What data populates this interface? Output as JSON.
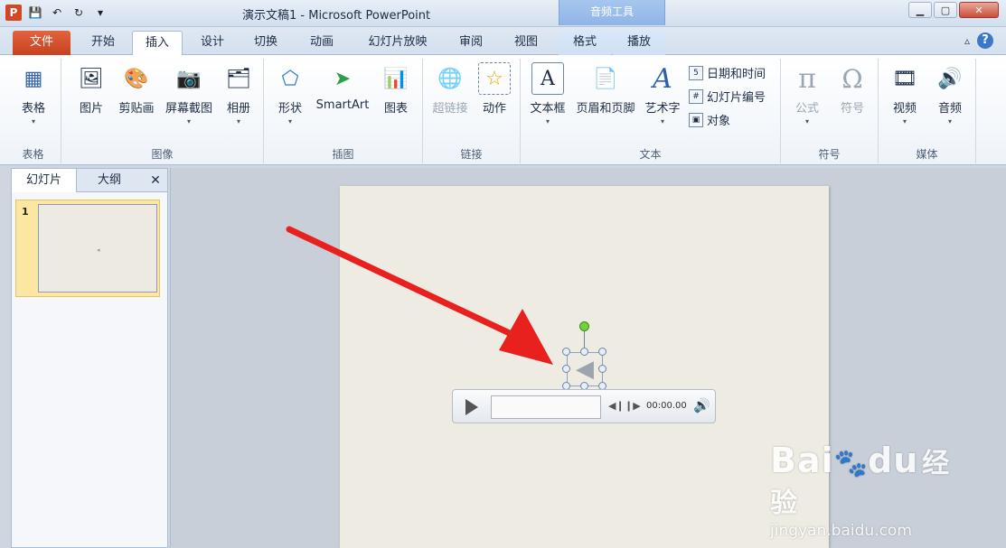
{
  "window": {
    "title": "演示文稿1 - Microsoft PowerPoint",
    "context_tab_group": "音频工具",
    "min_label": "▁",
    "max_label": "▢",
    "close_label": "✕"
  },
  "qat": {
    "logo": "P",
    "save": "💾",
    "undo": "↶",
    "redo": "↻",
    "customize": "▾"
  },
  "tabs": [
    {
      "label": "文件"
    },
    {
      "label": "开始"
    },
    {
      "label": "插入"
    },
    {
      "label": "设计"
    },
    {
      "label": "切换"
    },
    {
      "label": "动画"
    },
    {
      "label": "幻灯片放映"
    },
    {
      "label": "审阅"
    },
    {
      "label": "视图"
    },
    {
      "label": "格式"
    },
    {
      "label": "播放"
    }
  ],
  "help": {
    "minimize_ribbon": "▵",
    "help": "?"
  },
  "ribbon": {
    "groups": {
      "table": "表格",
      "images": "图像",
      "illustrations": "插图",
      "links": "链接",
      "text": "文本",
      "symbols": "符号",
      "media": "媒体"
    },
    "buttons": {
      "table": "表格",
      "picture": "图片",
      "clipart": "剪贴画",
      "screenshot": "屏幕截图",
      "album": "相册",
      "shapes": "形状",
      "smartart": "SmartArt",
      "chart": "图表",
      "hyperlink": "超链接",
      "action": "动作",
      "textbox": "文本框",
      "header_footer": "页眉和页脚",
      "wordart": "艺术字",
      "datetime": "日期和时间",
      "slide_number": "幻灯片编号",
      "object": "对象",
      "equation": "公式",
      "symbol": "符号",
      "video": "视频",
      "audio": "音频"
    },
    "small_icons": {
      "datetime": "5",
      "slide_number": "#",
      "object": "▣"
    },
    "glyphs": {
      "table": "▦",
      "picture": "🖼",
      "clipart": "🎨",
      "screenshot": "📷",
      "album": "🗂",
      "shapes": "⬠",
      "smartart": "➤",
      "chart": "📊",
      "hyperlink": "🌐",
      "action": "☆",
      "textbox": "A",
      "header_footer": "📄",
      "wordart": "A",
      "equation": "π",
      "symbol": "Ω",
      "video": "🎞",
      "audio": "🔊",
      "dropdown": "▾"
    }
  },
  "left_panel": {
    "tab_slides": "幻灯片",
    "tab_outline": "大纲",
    "close": "✕",
    "slide_number": "1",
    "thumb_icon": "◂"
  },
  "player": {
    "time": "00:00.00",
    "back": "◀❙",
    "forward": "❙▶",
    "volume": "🔊",
    "speaker_glyph": "◀"
  },
  "watermark": {
    "brand": "Bai",
    "brand_suffix": "du",
    "paw": "🐾",
    "cn": "经验",
    "site": "jingyan.baidu.com"
  },
  "colors": {
    "file_tab": "#d24726",
    "accent_blue": "#3c78c8",
    "arrow_red": "#e8201e",
    "rotate_handle": "#73d13e"
  }
}
